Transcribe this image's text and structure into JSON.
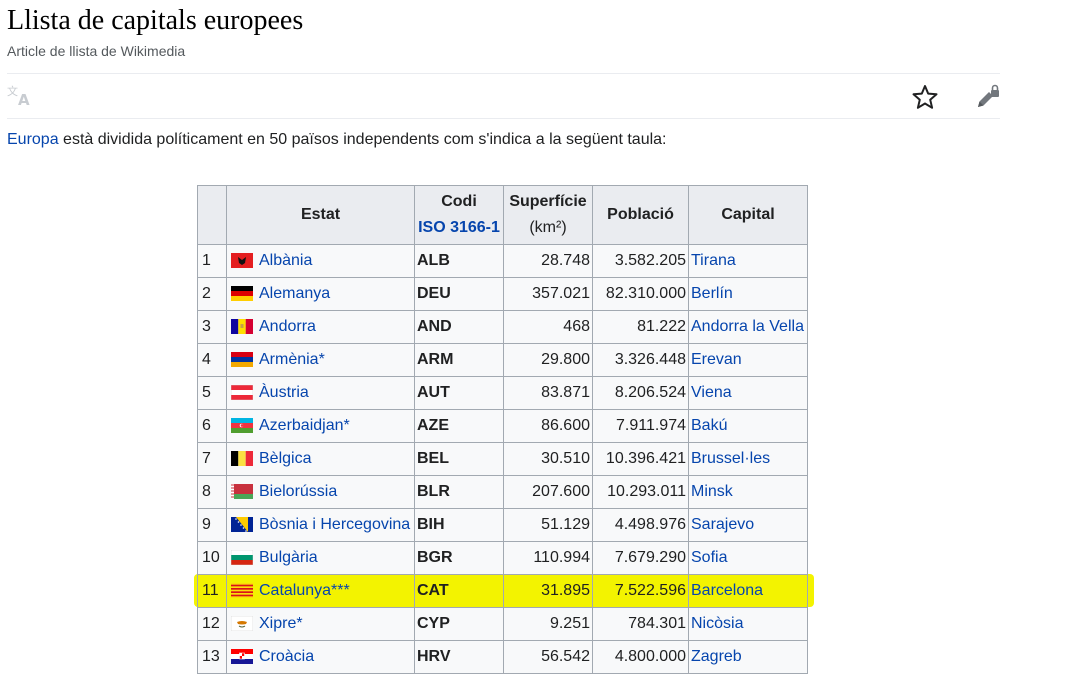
{
  "page": {
    "title": "Llista de capitals europees",
    "subtitle": "Article de llista de Wikimedia"
  },
  "intro": {
    "link": "Europa",
    "text": " està dividida políticament en 50 països independents com s'indica a la següent taula:"
  },
  "table": {
    "headers": {
      "estat": "Estat",
      "codi": "Codi",
      "codi_link": "ISO 3166-1",
      "superficie": "Superfície",
      "superficie_unit": "(km²)",
      "poblacio": "Població",
      "capital": "Capital"
    },
    "rows": [
      {
        "n": "1",
        "country": "Albània",
        "code": "ALB",
        "area": "28.748",
        "pop": "3.582.205",
        "capital": "Tirana",
        "flag": "albania-flag-icon"
      },
      {
        "n": "2",
        "country": "Alemanya",
        "code": "DEU",
        "area": "357.021",
        "pop": "82.310.000",
        "capital": "Berlín",
        "flag": "germany-flag-icon"
      },
      {
        "n": "3",
        "country": "Andorra",
        "code": "AND",
        "area": "468",
        "pop": "81.222",
        "capital": "Andorra la Vella",
        "flag": "andorra-flag-icon"
      },
      {
        "n": "4",
        "country": "Armènia*",
        "code": "ARM",
        "area": "29.800",
        "pop": "3.326.448",
        "capital": "Erevan",
        "flag": "armenia-flag-icon"
      },
      {
        "n": "5",
        "country": "Àustria",
        "code": "AUT",
        "area": "83.871",
        "pop": "8.206.524",
        "capital": "Viena",
        "flag": "austria-flag-icon"
      },
      {
        "n": "6",
        "country": "Azerbaidjan*",
        "code": "AZE",
        "area": "86.600",
        "pop": "7.911.974",
        "capital": "Bakú",
        "flag": "azerbaijan-flag-icon"
      },
      {
        "n": "7",
        "country": "Bèlgica",
        "code": "BEL",
        "area": "30.510",
        "pop": "10.396.421",
        "capital": "Brussel·les",
        "flag": "belgium-flag-icon"
      },
      {
        "n": "8",
        "country": "Bielorússia",
        "code": "BLR",
        "area": "207.600",
        "pop": "10.293.011",
        "capital": "Minsk",
        "flag": "belarus-flag-icon"
      },
      {
        "n": "9",
        "country": "Bòsnia i Hercegovina",
        "code": "BIH",
        "area": "51.129",
        "pop": "4.498.976",
        "capital": "Sarajevo",
        "flag": "bosnia-flag-icon"
      },
      {
        "n": "10",
        "country": "Bulgària",
        "code": "BGR",
        "area": "110.994",
        "pop": "7.679.290",
        "capital": "Sofia",
        "flag": "bulgaria-flag-icon"
      },
      {
        "n": "11",
        "country": "Catalunya***",
        "code": "CAT",
        "area": "31.895",
        "pop": "7.522.596",
        "capital": "Barcelona",
        "flag": "catalonia-flag-icon"
      },
      {
        "n": "12",
        "country": "Xipre*",
        "code": "CYP",
        "area": "9.251",
        "pop": "784.301",
        "capital": "Nicòsia",
        "flag": "cyprus-flag-icon"
      },
      {
        "n": "13",
        "country": "Croàcia",
        "code": "HRV",
        "area": "56.542",
        "pop": "4.800.000",
        "capital": "Zagreb",
        "flag": "croatia-flag-icon"
      }
    ]
  },
  "icons": {
    "translate": "translate-icon",
    "star": "star-icon",
    "edit": "edit-lock-icon"
  },
  "colors": {
    "link": "#0645ad",
    "highlight": "#f3f300",
    "header_bg": "#eaecf0"
  }
}
